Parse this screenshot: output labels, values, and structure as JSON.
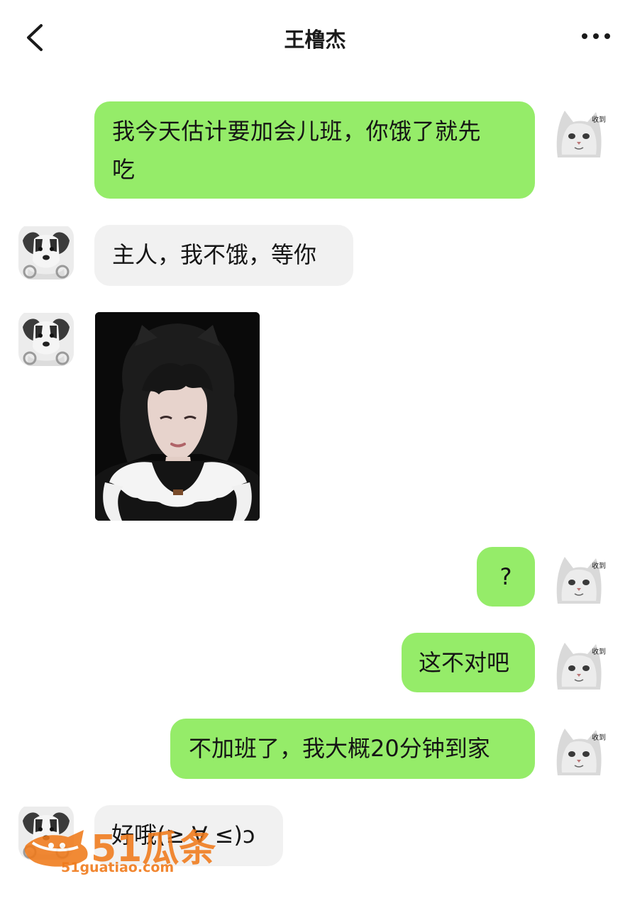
{
  "header": {
    "title": "王橹杰",
    "back_icon": "chevron-left-icon",
    "more_icon": "more-dots-icon"
  },
  "avatars": {
    "me_sticker_text": "收到",
    "me_icon": "cat-avatar",
    "other_icon": "dog-avatar"
  },
  "messages": [
    {
      "from": "me",
      "text_line1": "我今天估计要加会儿班，你饿了就先",
      "text_line2": "吃"
    },
    {
      "from": "other",
      "text": "主人，我不饿，等你"
    },
    {
      "from": "other",
      "type": "image",
      "image": "selfie-photo"
    },
    {
      "from": "me",
      "text": "?"
    },
    {
      "from": "me",
      "text": "这不对吧"
    },
    {
      "from": "me",
      "text": "不加班了，我大概20分钟到家"
    },
    {
      "from": "other",
      "text": "好哦(≥ ∀ ≤)ɔ"
    }
  ],
  "watermark": {
    "logo_text": "51瓜条",
    "url": "51guatiao.com",
    "color": "#f07a1a"
  },
  "colors": {
    "my_bubble": "#95ec69",
    "other_bubble": "#f1f1f1",
    "background": "#ffffff"
  }
}
